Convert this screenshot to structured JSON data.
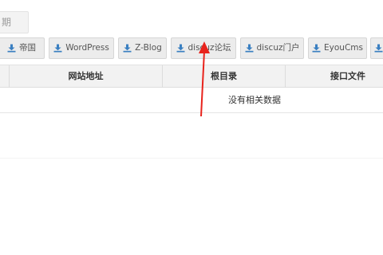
{
  "top_fragment": {
    "label": "期"
  },
  "toolbar": {
    "buttons": [
      {
        "label": "帝国",
        "icon": "download-icon"
      },
      {
        "label": "WordPress",
        "icon": "download-icon"
      },
      {
        "label": "Z-Blog",
        "icon": "download-icon"
      },
      {
        "label": "discuz论坛",
        "icon": "download-icon"
      },
      {
        "label": "discuz门户",
        "icon": "download-icon"
      },
      {
        "label": "EyouCms",
        "icon": "download-icon"
      },
      {
        "label": "",
        "icon": "download-icon"
      }
    ]
  },
  "table": {
    "columns": [
      "网站地址",
      "根目录",
      "接口文件"
    ],
    "empty_message": "没有相关数据"
  },
  "colors": {
    "icon_blue": "#3a7fc1",
    "annotation_arrow": "#e8231c",
    "button_bg": "#ececec",
    "header_bg": "#f2f2f2"
  }
}
